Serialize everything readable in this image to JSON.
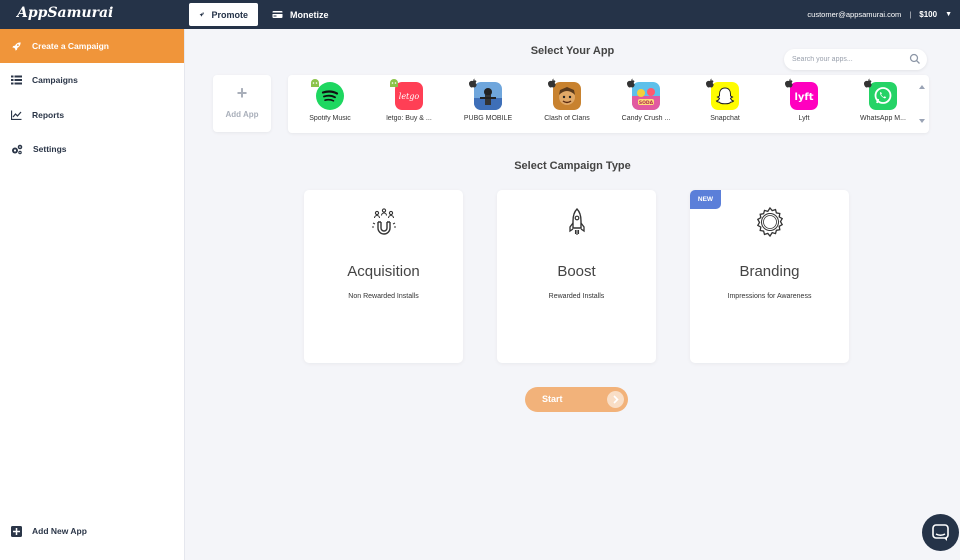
{
  "header": {
    "logo": "AppSamurai",
    "tabs": [
      {
        "label": "Promote",
        "icon": "rocket-icon",
        "active": true
      },
      {
        "label": "Monetize",
        "icon": "card-icon",
        "active": false
      }
    ],
    "user_email": "customer@appsamurai.com",
    "separator": "|",
    "balance": "$100"
  },
  "sidebar": {
    "items": [
      {
        "label": "Create a Campaign",
        "icon": "rocket-icon",
        "active": true
      },
      {
        "label": "Campaigns",
        "icon": "list-icon",
        "active": false
      },
      {
        "label": "Reports",
        "icon": "chart-icon",
        "active": false
      },
      {
        "label": "Settings",
        "icon": "gears-icon",
        "active": false
      }
    ],
    "add_new_app": "Add New App"
  },
  "app_select": {
    "title": "Select Your App",
    "search_placeholder": "Search your apps...",
    "add_app_label": "Add App",
    "apps": [
      {
        "name": "Spotify Music",
        "platform": "android",
        "color": "#1ed760"
      },
      {
        "name": "letgo: Buy & ...",
        "platform": "android",
        "color": "#ff3f55"
      },
      {
        "name": "PUBG MOBILE",
        "platform": "ios",
        "color": "#3e6fb8"
      },
      {
        "name": "Clash of Clans",
        "platform": "ios",
        "color": "#8a5a2b"
      },
      {
        "name": "Candy Crush ...",
        "platform": "ios",
        "color": "#e25aa0"
      },
      {
        "name": "Snapchat",
        "platform": "ios",
        "color": "#fffc00"
      },
      {
        "name": "Lyft",
        "platform": "ios",
        "color": "#ff00bf"
      },
      {
        "name": "WhatsApp M...",
        "platform": "ios",
        "color": "#25d366"
      }
    ]
  },
  "campaign_type": {
    "title": "Select Campaign Type",
    "cards": [
      {
        "title": "Acquisition",
        "subtitle": "Non Rewarded Installs",
        "icon": "magnet-people-icon"
      },
      {
        "title": "Boost",
        "subtitle": "Rewarded Installs",
        "icon": "rocket-icon"
      },
      {
        "title": "Branding",
        "subtitle": "Impressions for Awareness",
        "icon": "brand-seal-icon",
        "badge": "NEW"
      }
    ]
  },
  "start_button": "Start",
  "colors": {
    "accent": "#f0953a",
    "navy": "#253348",
    "badge": "#5b7fd9",
    "start": "#f2b27a"
  }
}
